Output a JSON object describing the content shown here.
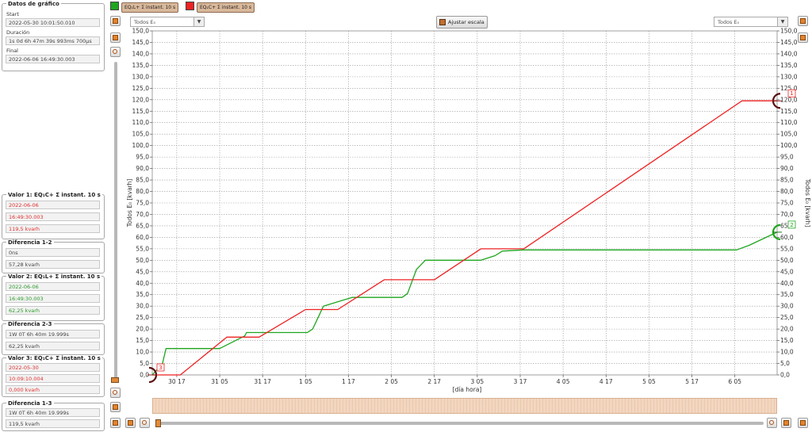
{
  "sidebar": {
    "datos": {
      "title": "Datos de gráfico",
      "start_label": "Start",
      "start_value": "2022-05-30 10:01:50.010",
      "duracion_label": "Duración",
      "duracion_value": "1s 0d 6h 47m 39s 993ms 700µs",
      "final_label": "Final",
      "final_value": "2022-06-06 16:49:30.003"
    },
    "valor1": {
      "title": "Valor 1: EQ₁C+ Σ instant. 10 s",
      "date": "2022-06-06",
      "time": "16:49:30.003",
      "value": "119,5 kvarh"
    },
    "dif12": {
      "title": "Diferencia 1-2",
      "time": "0ns",
      "value": "57,28 kvarh"
    },
    "valor2": {
      "title": "Valor 2: EQ₁L+ Σ instant. 10 s",
      "date": "2022-06-06",
      "time": "16:49:30.003",
      "value": "62,25 kvarh"
    },
    "dif23": {
      "title": "Diferencia 2-3",
      "time": "1W 0T 6h 40m 19.999s",
      "value": "62,25 kvarh"
    },
    "valor3": {
      "title": "Valor 3: EQ₁C+ Σ instant. 10 s",
      "date": "2022-05-30",
      "time": "10:09:10.004",
      "value": "0,000 kvarh"
    },
    "dif13": {
      "title": "Diferencia 1-3",
      "time": "1W 0T 6h 40m 19.999s",
      "value": "119,5 kvarh"
    }
  },
  "toolbar": {
    "legend_green": "EQ₁L+ Σ instant. 10 s",
    "legend_red": "EQ₁C+ Σ instant. 10 s",
    "combo_left": "Todos E₀",
    "combo_right": "Todos E₀",
    "ajustar": "Ajustar escala",
    "combo_arrow": "▼"
  },
  "colors": {
    "green": "#1fa51f",
    "red": "#ee2222",
    "legend_bg": "#d9b89a",
    "scroll": "#f2d6c0"
  },
  "chart_data": {
    "type": "line",
    "xlabel": "[día hora]",
    "ylabel_left": "Todos E₀ [kvarh]",
    "ylabel_right": "Todos E₀ [kvarh]",
    "ylim": [
      0,
      150
    ],
    "ytick_step": 5,
    "x_ticks": [
      "30 17",
      "31 05",
      "31 17",
      "1 05",
      "1 17",
      "2 05",
      "2 17",
      "3 05",
      "3 17",
      "4 05",
      "4 17",
      "5 05",
      "5 17",
      "6 05"
    ],
    "grid": true,
    "markers": [
      {
        "label": "1",
        "series": "EQ₁C+ Σ instant. 10 s",
        "y": 119.5
      },
      {
        "label": "2",
        "series": "EQ₁L+ Σ instant. 10 s",
        "y": 62.25
      },
      {
        "label": "3",
        "series": "EQ₁C+ Σ instant. 10 s",
        "y": 0
      }
    ],
    "series": [
      {
        "name": "EQ₁L+ Σ instant. 10 s",
        "color": "#1fa51f",
        "x": [
          "30 10:09",
          "30 13:00",
          "30 14:00",
          "31 05:00",
          "31 12:00",
          "31 12:30",
          "1 05:30",
          "1 07:00",
          "1 10:00",
          "1 18:00",
          "2 08:00",
          "2 09:30",
          "2 12:00",
          "2 14:30",
          "3 06:00",
          "3 10:00",
          "3 12:00",
          "3 18:00",
          "6 05:30",
          "6 09:00",
          "6 16:49"
        ],
        "y": [
          0,
          5,
          11.5,
          11.5,
          17,
          18.5,
          18.5,
          20,
          30,
          33.8,
          33.8,
          35.5,
          46,
          50,
          50,
          52,
          54,
          54.5,
          54.5,
          56.5,
          62.25
        ]
      },
      {
        "name": "EQ₁C+ Σ instant. 10 s",
        "color": "#ee2222",
        "x": [
          "30 10:09",
          "30 18:00",
          "31 07:00",
          "31 16:00",
          "1 05:00",
          "1 14:00",
          "2 03:00",
          "2 17:00",
          "3 06:00",
          "3 18:00",
          "6 07:00",
          "6 16:49"
        ],
        "y": [
          0,
          0,
          16.5,
          16.5,
          28.5,
          28.5,
          41.5,
          41.5,
          55,
          55,
          119.5,
          119.5
        ]
      }
    ]
  }
}
